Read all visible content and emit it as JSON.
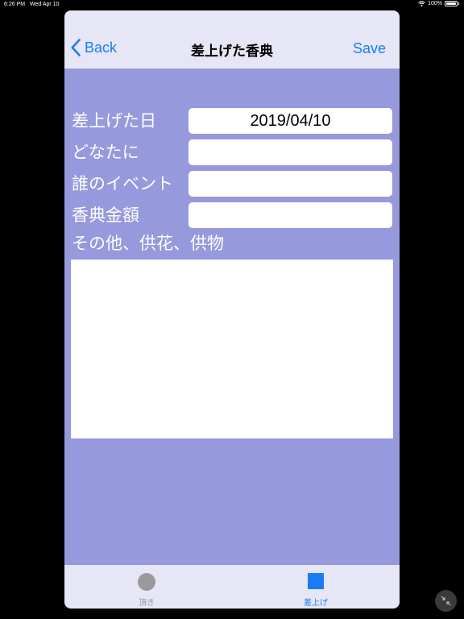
{
  "status_bar": {
    "time": "6:26 PM",
    "date": "Wed Apr 10",
    "battery": "100%"
  },
  "navbar": {
    "back_label": "Back",
    "title": "差上げた香典",
    "save_label": "Save"
  },
  "form": {
    "date_label": "差上げた日",
    "date_value": "2019/04/10",
    "recipient_label": "どなたに",
    "recipient_value": "",
    "event_label": "誰のイベント",
    "event_value": "",
    "amount_label": "香典金額",
    "amount_value": "",
    "notes_label": "その他、供花、供物",
    "notes_value": ""
  },
  "tabbar": {
    "tabs": [
      {
        "label": "頂き",
        "icon": "circle-icon",
        "selected": false
      },
      {
        "label": "差上げ",
        "icon": "square-icon",
        "selected": true
      }
    ]
  },
  "colors": {
    "accent": "#1a7cf5",
    "form_background": "#9699dc",
    "bar_background": "#e6e6f6"
  }
}
